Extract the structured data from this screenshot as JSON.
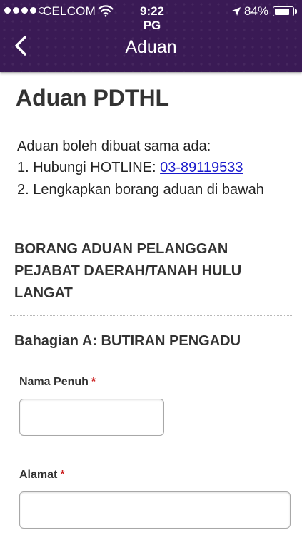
{
  "status_bar": {
    "carrier": "CELCOM",
    "time": "9:22 PG",
    "battery_percent": "84%",
    "battery_level": 0.84,
    "signal_bars_filled": 4,
    "signal_bars_total": 5,
    "icons": [
      "wifi-icon",
      "location-arrow-icon",
      "battery-icon"
    ]
  },
  "nav": {
    "title": "Aduan",
    "back_icon": "chevron-left-icon"
  },
  "page": {
    "title": "Aduan PDTHL",
    "intro": "Aduan boleh dibuat sama ada:",
    "step1_prefix": "1. Hubungi HOTLINE: ",
    "hotline": "03-89119533",
    "step2": "2. Lengkapkan borang aduan di bawah"
  },
  "form": {
    "heading": "BORANG ADUAN PELANGGAN PEJABAT DAERAH/TANAH HULU LANGAT",
    "section_a": "Bahagian A: BUTIRAN PENGADU",
    "fields": [
      {
        "label": "Nama Penuh",
        "required_mark": "*",
        "value": ""
      },
      {
        "label": "Alamat",
        "required_mark": "*",
        "value": ""
      }
    ]
  },
  "colors": {
    "header_bg": "#3a1a55",
    "link": "#1a1acc",
    "required": "#cc2222"
  }
}
